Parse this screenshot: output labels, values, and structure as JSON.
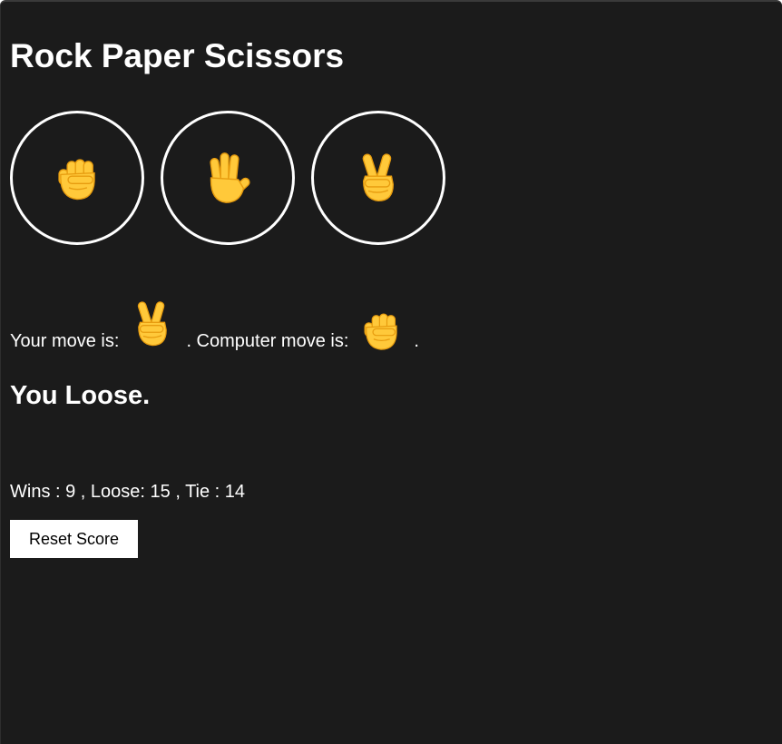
{
  "title": "Rock Paper Scissors",
  "moves": [
    {
      "name": "rock",
      "icon": "raised-fist-icon"
    },
    {
      "name": "paper",
      "icon": "raised-hand-icon"
    },
    {
      "name": "scissors",
      "icon": "victory-hand-icon"
    }
  ],
  "result": {
    "your_move_label": "Your move is:",
    "your_move_icon": "victory-hand-icon",
    "computer_move_label": ". Computer move is:",
    "computer_move_icon": "raised-fist-icon",
    "end": "."
  },
  "outcome": "You Loose.",
  "score": {
    "text": "Wins : 9 , Loose: 15 , Tie : 14",
    "wins": 9,
    "loose": 15,
    "tie": 14
  },
  "reset_label": "Reset Score",
  "colors": {
    "background": "#1b1b1b",
    "text": "#ffffff",
    "emoji_skin": "#ffc93a",
    "emoji_outline": "#e79c0f"
  }
}
